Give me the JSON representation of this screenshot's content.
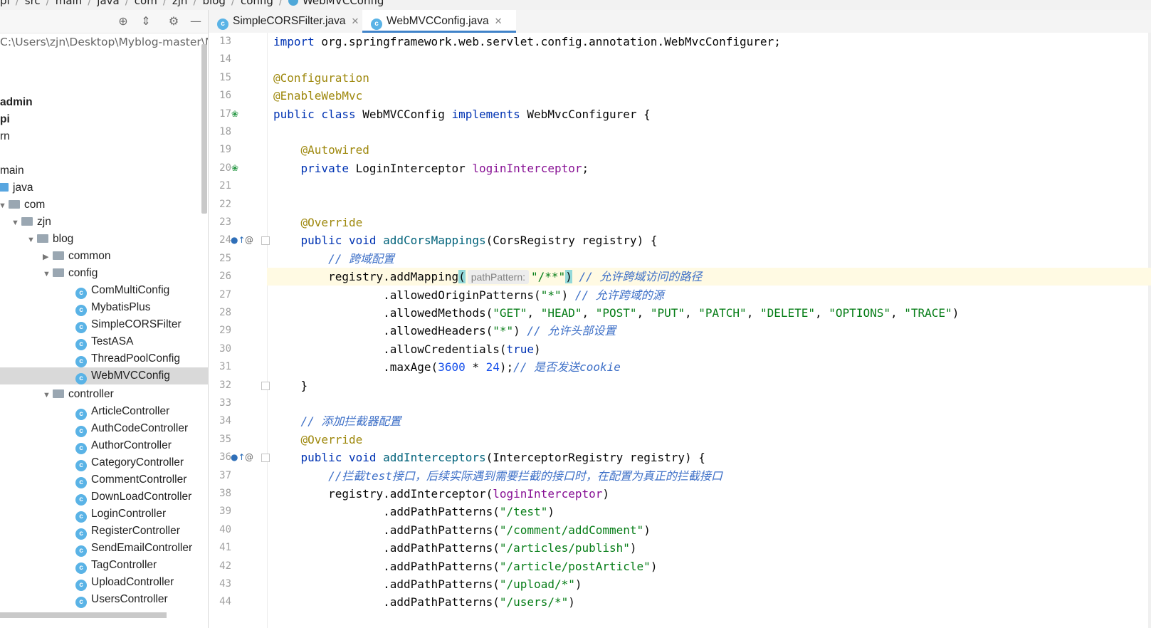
{
  "breadcrumb": [
    "pi",
    "src",
    "main",
    "java",
    "com",
    "zjn",
    "blog",
    "config",
    "WebMVCConfig"
  ],
  "project_path": "C:\\Users\\zjn\\Desktop\\Myblog-master\\MyE",
  "tree": [
    {
      "label": "admin",
      "bold": true,
      "indent": 0
    },
    {
      "label": "pi",
      "bold": true,
      "indent": 0
    },
    {
      "label": "rn",
      "indent": 0
    },
    {
      "label": "main",
      "indent": 0
    },
    {
      "label": "java",
      "type": "folder-blue",
      "indent": 0
    },
    {
      "label": "com",
      "type": "folder",
      "arrow": "▼",
      "indent": 1
    },
    {
      "label": "zjn",
      "type": "folder",
      "arrow": "▼",
      "indent": 2
    },
    {
      "label": "blog",
      "type": "folder",
      "arrow": "▼",
      "indent": 3
    },
    {
      "label": "common",
      "type": "folder",
      "arrow": "▶",
      "indent": 4
    },
    {
      "label": "config",
      "type": "folder",
      "arrow": "▼",
      "indent": 4
    },
    {
      "label": "ComMultiConfig",
      "type": "class",
      "indent": 5
    },
    {
      "label": "MybatisPlus",
      "type": "class",
      "indent": 5
    },
    {
      "label": "SimpleCORSFilter",
      "type": "class",
      "indent": 5
    },
    {
      "label": "TestASA",
      "type": "class",
      "indent": 5
    },
    {
      "label": "ThreadPoolConfig",
      "type": "class",
      "indent": 5
    },
    {
      "label": "WebMVCConfig",
      "type": "class",
      "indent": 5,
      "selected": true
    },
    {
      "label": "controller",
      "type": "folder",
      "arrow": "▼",
      "indent": 4
    },
    {
      "label": "ArticleController",
      "type": "class",
      "indent": 5
    },
    {
      "label": "AuthCodeController",
      "type": "class",
      "indent": 5
    },
    {
      "label": "AuthorController",
      "type": "class",
      "indent": 5
    },
    {
      "label": "CategoryController",
      "type": "class",
      "indent": 5
    },
    {
      "label": "CommentController",
      "type": "class",
      "indent": 5
    },
    {
      "label": "DownLoadController",
      "type": "class",
      "indent": 5
    },
    {
      "label": "LoginController",
      "type": "class",
      "indent": 5
    },
    {
      "label": "RegisterController",
      "type": "class",
      "indent": 5
    },
    {
      "label": "SendEmailController",
      "type": "class",
      "indent": 5
    },
    {
      "label": "TagController",
      "type": "class",
      "indent": 5
    },
    {
      "label": "UploadController",
      "type": "class",
      "indent": 5
    },
    {
      "label": "UsersController",
      "type": "class",
      "indent": 5
    }
  ],
  "tabs": [
    {
      "label": "SimpleCORSFilter.java",
      "active": false
    },
    {
      "label": "WebMVCConfig.java",
      "active": true
    }
  ],
  "class_icon_letter": "c",
  "code_lines": [
    {
      "n": "13",
      "html": "<span class=\"kw\">import</span> org.springframework.web.servlet.config.annotation.WebMvcConfigurer;"
    },
    {
      "n": "14",
      "html": ""
    },
    {
      "n": "15",
      "html": "<span class=\"ann\">@Configuration</span>"
    },
    {
      "n": "16",
      "html": "<span class=\"ann\">@EnableWebMvc</span>"
    },
    {
      "n": "17",
      "html": "<span class=\"kw\">public class</span> WebMVCConfig <span class=\"kw\">implements</span> WebMvcConfigurer {",
      "icon": "bean"
    },
    {
      "n": "18",
      "html": ""
    },
    {
      "n": "19",
      "html": "    <span class=\"ann\">@Autowired</span>"
    },
    {
      "n": "20",
      "html": "    <span class=\"kw\">private</span> LoginInterceptor <span class=\"field\">loginInterceptor</span>;",
      "icon": "bean"
    },
    {
      "n": "21",
      "html": ""
    },
    {
      "n": "22",
      "html": ""
    },
    {
      "n": "23",
      "html": "    <span class=\"ann\">@Override</span>"
    },
    {
      "n": "24",
      "html": "    <span class=\"kw\">public void</span> <span class=\"method\">addCorsMappings</span>(CorsRegistry registry) {",
      "icon": "override"
    },
    {
      "n": "25",
      "html": "        <span class=\"cmt-zh\">// 跨域配置</span>"
    },
    {
      "n": "26",
      "html": "        registry.addMapping<span class=\"bracket\">(</span><span class=\"hint\">pathPattern:</span><span class=\"str\">\"/**\"</span><span class=\"bracket\">)</span> <span class=\"cmt-zh\">// 允许跨域访问的路径</span>",
      "highlight": true
    },
    {
      "n": "27",
      "html": "                .allowedOriginPatterns(<span class=\"str\">\"*\"</span>) <span class=\"cmt-zh\">// 允许跨域的源</span>"
    },
    {
      "n": "28",
      "html": "                .allowedMethods(<span class=\"str\">\"GET\"</span>, <span class=\"str\">\"HEAD\"</span>, <span class=\"str\">\"POST\"</span>, <span class=\"str\">\"PUT\"</span>, <span class=\"str\">\"PATCH\"</span>, <span class=\"str\">\"DELETE\"</span>, <span class=\"str\">\"OPTIONS\"</span>, <span class=\"str\">\"TRACE\"</span>)"
    },
    {
      "n": "29",
      "html": "                .allowedHeaders(<span class=\"str\">\"*\"</span>) <span class=\"cmt-zh\">// 允许头部设置</span>"
    },
    {
      "n": "30",
      "html": "                .allowCredentials(<span class=\"kw\">true</span>)"
    },
    {
      "n": "31",
      "html": "                .maxAge(<span class=\"num\">3600</span> * <span class=\"num\">24</span>);<span class=\"cmt-zh\">// 是否发送cookie</span>"
    },
    {
      "n": "32",
      "html": "    }"
    },
    {
      "n": "33",
      "html": ""
    },
    {
      "n": "34",
      "html": "    <span class=\"cmt-zh\">// 添加拦截器配置</span>"
    },
    {
      "n": "35",
      "html": "    <span class=\"ann\">@Override</span>"
    },
    {
      "n": "36",
      "html": "    <span class=\"kw\">public void</span> <span class=\"method\">addInterceptors</span>(InterceptorRegistry registry) {",
      "icon": "override"
    },
    {
      "n": "37",
      "html": "        <span class=\"cmt-zh\">//拦截test接口，后续实际遇到需要拦截的接口时，在配置为真正的拦截接口</span>"
    },
    {
      "n": "38",
      "html": "        registry.addInterceptor(<span class=\"field\">loginInterceptor</span>)"
    },
    {
      "n": "39",
      "html": "                .addPathPatterns(<span class=\"str\">\"/test\"</span>)"
    },
    {
      "n": "40",
      "html": "                .addPathPatterns(<span class=\"str\">\"/comment/addComment\"</span>)"
    },
    {
      "n": "41",
      "html": "                .addPathPatterns(<span class=\"str\">\"/articles/publish\"</span>)"
    },
    {
      "n": "42",
      "html": "                .addPathPatterns(<span class=\"str\">\"/article/postArticle\"</span>)"
    },
    {
      "n": "43",
      "html": "                .addPathPatterns(<span class=\"str\">\"/upload/*\"</span>)"
    },
    {
      "n": "44",
      "html": "                .addPathPatterns(<span class=\"str\">\"/users/*\"</span>)"
    }
  ],
  "icons": {
    "bean_glyph": "❀",
    "override_glyph": "●↑",
    "at_glyph": "@",
    "crosshair_glyph": "⊕",
    "collapse_glyph": "⇕",
    "gear_glyph": "⚙",
    "minimize_glyph": "—",
    "close_glyph": "✕"
  },
  "colors": {
    "keyword": "#0033b3",
    "annotation": "#9e880d",
    "string": "#067d17",
    "comment": "#3d6fc7",
    "selection": "#d9d9d9",
    "highlight_line": "#fffae3",
    "tab_underline": "#4083c9"
  }
}
